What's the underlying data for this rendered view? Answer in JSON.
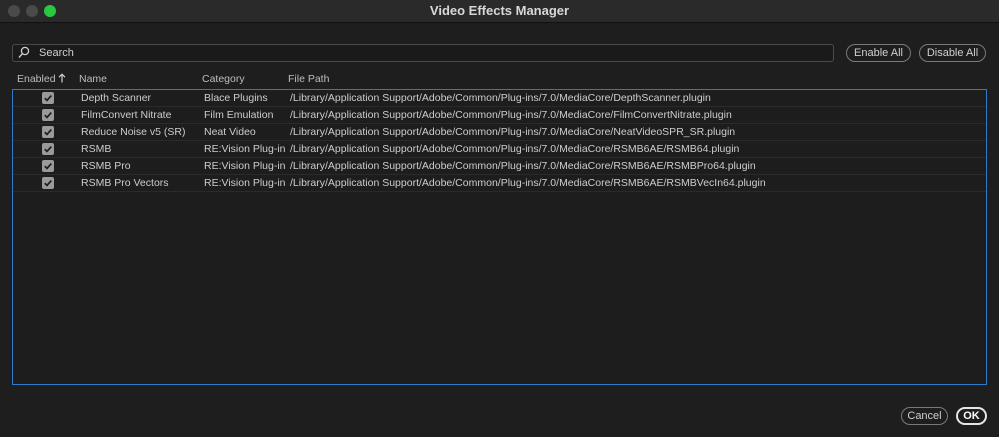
{
  "window": {
    "title": "Video Effects Manager",
    "accent": "#2d7ac9"
  },
  "search": {
    "placeholder": "Search",
    "value": ""
  },
  "toolbar": {
    "enable_all_label": "Enable All",
    "disable_all_label": "Disable All"
  },
  "table": {
    "columns": {
      "enabled": "Enabled",
      "name": "Name",
      "category": "Category",
      "path": "File Path"
    },
    "rows": [
      {
        "enabled": true,
        "name": "Depth Scanner",
        "category": "Blace Plugins",
        "path": "/Library/Application Support/Adobe/Common/Plug-ins/7.0/MediaCore/DepthScanner.plugin"
      },
      {
        "enabled": true,
        "name": "FilmConvert Nitrate",
        "category": "Film Emulation",
        "path": "/Library/Application Support/Adobe/Common/Plug-ins/7.0/MediaCore/FilmConvertNitrate.plugin"
      },
      {
        "enabled": true,
        "name": "Reduce Noise v5 (SR)",
        "category": "Neat Video",
        "path": "/Library/Application Support/Adobe/Common/Plug-ins/7.0/MediaCore/NeatVideoSPR_SR.plugin"
      },
      {
        "enabled": true,
        "name": "RSMB",
        "category": "RE:Vision Plug-ins",
        "path": "/Library/Application Support/Adobe/Common/Plug-ins/7.0/MediaCore/RSMB6AE/RSMB64.plugin"
      },
      {
        "enabled": true,
        "name": "RSMB Pro",
        "category": "RE:Vision Plug-ins",
        "path": "/Library/Application Support/Adobe/Common/Plug-ins/7.0/MediaCore/RSMB6AE/RSMBPro64.plugin"
      },
      {
        "enabled": true,
        "name": "RSMB Pro Vectors",
        "category": "RE:Vision Plug-ins",
        "path": "/Library/Application Support/Adobe/Common/Plug-ins/7.0/MediaCore/RSMB6AE/RSMBVecIn64.plugin"
      }
    ]
  },
  "footer": {
    "cancel_label": "Cancel",
    "ok_label": "OK"
  }
}
